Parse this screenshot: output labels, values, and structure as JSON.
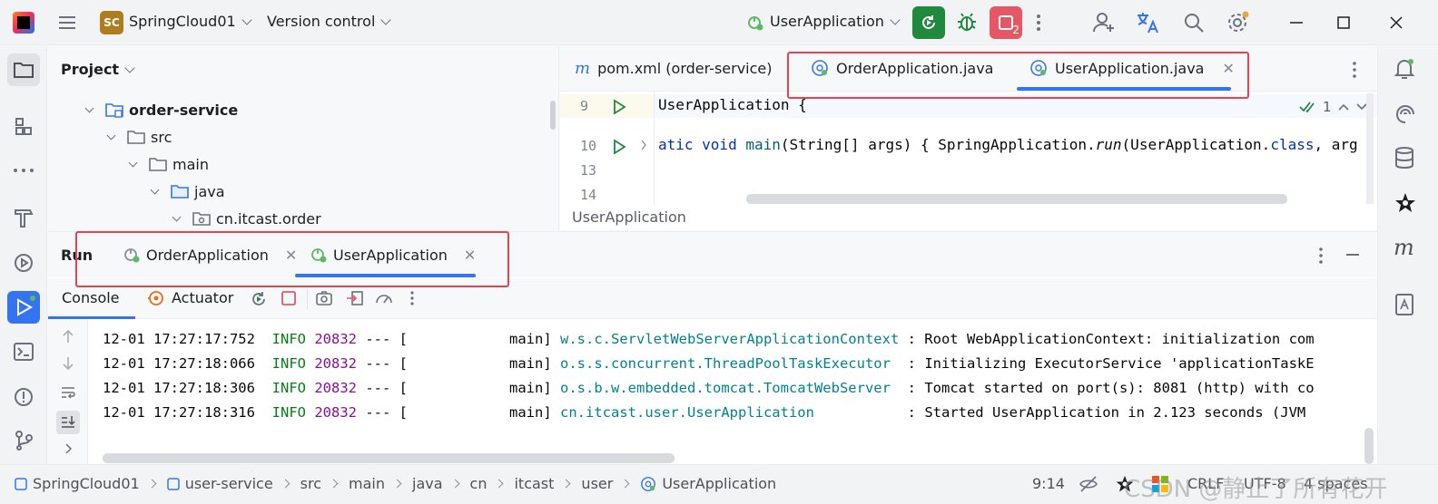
{
  "titlebar": {
    "project_badge": "SC",
    "project_name": "SpringCloud01",
    "vcs_label": "Version control",
    "run_config": "UserApplication",
    "stop_count": "2"
  },
  "project_panel": {
    "title": "Project",
    "tree": [
      {
        "label": "order-service",
        "bold": true
      },
      {
        "label": "src"
      },
      {
        "label": "main"
      },
      {
        "label": "java"
      },
      {
        "label": "cn.itcast.order"
      }
    ]
  },
  "editor": {
    "tabs": [
      {
        "label": "pom.xml (order-service)",
        "icon": "maven-icon"
      },
      {
        "label": "OrderApplication.java",
        "icon": "spring-boot-class-icon"
      },
      {
        "label": "UserApplication.java",
        "icon": "spring-boot-class-icon",
        "active": true
      }
    ],
    "line_numbers": [
      "9",
      "10",
      "13",
      "14"
    ],
    "code": {
      "line9": "UserApplication {",
      "line10_kw": "atic void ",
      "line10_fn": "main",
      "line10_args": "(String[] args) { SpringApplication.",
      "line10_run": "run",
      "line10_rest": "(UserApplication.",
      "line10_class": "class",
      "line10_tail": ", arg"
    },
    "inspection_count": "1",
    "breadcrumb": "UserApplication"
  },
  "run_panel": {
    "title": "Run",
    "tabs": [
      {
        "label": "OrderApplication"
      },
      {
        "label": "UserApplication",
        "active": true
      }
    ],
    "subtabs": {
      "console": "Console",
      "actuator": "Actuator"
    },
    "log_lines": [
      {
        "ts": "12-01 17:27:17:752",
        "level": "INFO",
        "pid": "20832",
        "sep": "--- [",
        "thread": "main]",
        "logger": "w.s.c.ServletWebServerApplicationContext",
        "msg": ": Root WebApplicationContext: initialization com"
      },
      {
        "ts": "12-01 17:27:18:066",
        "level": "INFO",
        "pid": "20832",
        "sep": "--- [",
        "thread": "main]",
        "logger": "o.s.s.concurrent.ThreadPoolTaskExecutor",
        "msg": ": Initializing ExecutorService 'applicationTaskE"
      },
      {
        "ts": "12-01 17:27:18:306",
        "level": "INFO",
        "pid": "20832",
        "sep": "--- [",
        "thread": "main]",
        "logger": "o.s.b.w.embedded.tomcat.TomcatWebServer",
        "msg": ": Tomcat started on port(s): 8081 (http) with co"
      },
      {
        "ts": "12-01 17:27:18:316",
        "level": "INFO",
        "pid": "20832",
        "sep": "--- [",
        "thread": "main]",
        "logger": "cn.itcast.user.UserApplication",
        "msg": ": Started UserApplication in 2.123 seconds (JVM"
      }
    ]
  },
  "statusbar": {
    "crumbs": [
      "SpringCloud01",
      "user-service",
      "src",
      "main",
      "java",
      "cn",
      "itcast",
      "user",
      "UserApplication"
    ],
    "position": "9:14",
    "line_sep": "CRLF",
    "encoding": "UTF-8",
    "indent": "4 spaces",
    "watermark": "CSDN @静止了所有花开"
  },
  "colors": {
    "accent": "#3574f0",
    "run_green": "#208a3c",
    "stop_red": "#e55765",
    "highlight_box": "#e8424f"
  }
}
